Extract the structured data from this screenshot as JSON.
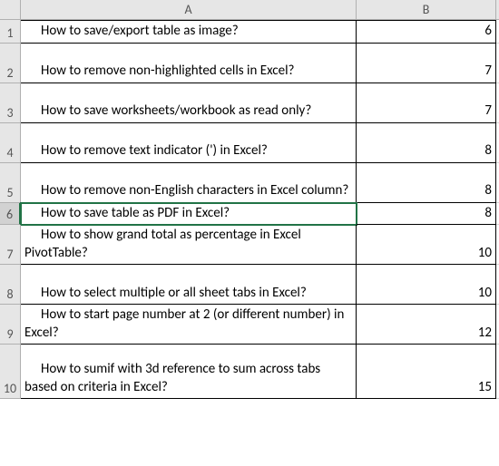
{
  "columns": {
    "A": "A",
    "B": "B"
  },
  "selected_row": 6,
  "rows": [
    {
      "n": "1",
      "h": "h1",
      "a": "How to save/export table as image?",
      "b": "6"
    },
    {
      "n": "2",
      "h": "h2",
      "a": "How to remove non-highlighted cells in Excel?",
      "b": "7"
    },
    {
      "n": "3",
      "h": "h2",
      "a": "How to save worksheets/workbook as read only?",
      "b": "7"
    },
    {
      "n": "4",
      "h": "h2",
      "a": "How to remove text indicator (') in Excel?",
      "b": "8"
    },
    {
      "n": "5",
      "h": "h2",
      "a": "How to remove non-English characters in Excel column?",
      "b": "8"
    },
    {
      "n": "6",
      "h": "h1",
      "a": "How to save table as PDF in Excel?",
      "b": "8"
    },
    {
      "n": "7",
      "h": "h2",
      "a": "How to show grand total as percentage in Excel PivotTable?",
      "b": "10"
    },
    {
      "n": "8",
      "h": "h2",
      "a": "How to select multiple or all sheet tabs in Excel?",
      "b": "10"
    },
    {
      "n": "9",
      "h": "h2",
      "a": "How to start page number at 2 (or different number) in Excel?",
      "b": "12"
    },
    {
      "n": "10",
      "h": "h3",
      "a": "How to sumif with 3d reference to sum across tabs based on criteria in Excel?",
      "b": "15"
    }
  ],
  "chart_data": {
    "type": "table",
    "columns": [
      "A",
      "B"
    ],
    "rows": [
      [
        "How to save/export table as image?",
        6
      ],
      [
        "How to remove non-highlighted cells in Excel?",
        7
      ],
      [
        "How to save worksheets/workbook as read only?",
        7
      ],
      [
        "How to remove text indicator (') in Excel?",
        8
      ],
      [
        "How to remove non-English characters in Excel column?",
        8
      ],
      [
        "How to save table as PDF in Excel?",
        8
      ],
      [
        "How to show grand total as percentage in Excel PivotTable?",
        10
      ],
      [
        "How to select multiple or all sheet tabs in Excel?",
        10
      ],
      [
        "How to start page number at 2 (or different number) in Excel?",
        12
      ],
      [
        "How to sumif with 3d reference to sum across tabs based on criteria in Excel?",
        15
      ]
    ]
  }
}
